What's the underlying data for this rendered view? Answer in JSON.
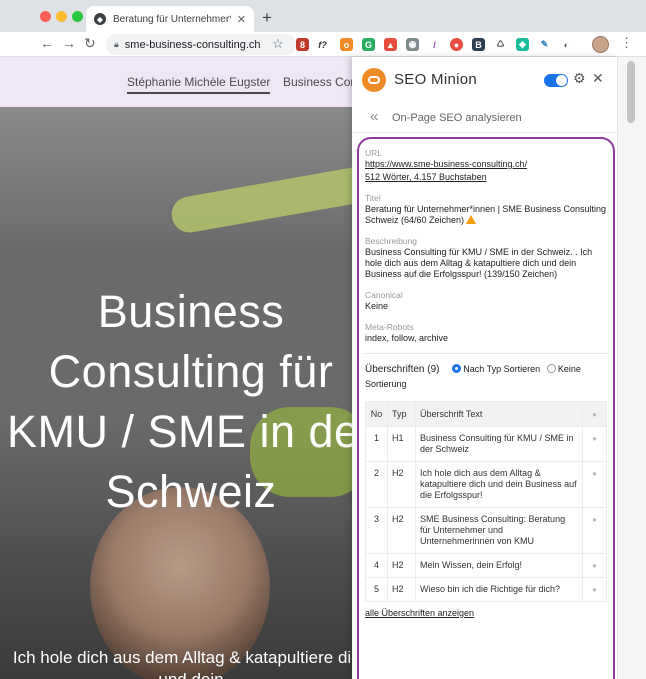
{
  "browser": {
    "tab_title": "Beratung für Unternehmer*inne",
    "new_tab": "+",
    "url": "sme-business-consulting.ch"
  },
  "site": {
    "nav": [
      "Stéphanie Michèle Eugster",
      "Business Cons"
    ],
    "hero_title": "Business Consulting für KMU / SME in der Schweiz",
    "hero_subtitle": "Ich hole dich aus dem Alltag & katapultiere dich und dein"
  },
  "panel": {
    "brand": "SEO Minion",
    "subtitle": "On-Page SEO analysieren",
    "url_label": "URL",
    "url_value": "https://www.sme-business-consulting.ch/",
    "url_stats": "512 Wörter, 4.157 Buchstaben",
    "title_label": "Titel",
    "title_value": "Beratung für Unternehmer*innen | SME Business Consulting Schweiz (64/60 Zeichen)",
    "desc_label": "Beschreibung",
    "desc_value": "Business Consulting für KMU / SME in der Schweiz. . Ich hole dich aus dem Alltag & katapultiere dich und dein Business auf die Erfolgsspur! (139/150 Zeichen)",
    "canonical_label": "Canonical",
    "canonical_value": "Keine",
    "robots_label": "Meta-Robots",
    "robots_value": "index, follow, archive",
    "headings_label": "Überschriften (9)",
    "sort_type": "Nach Typ Sortieren",
    "sort_none": "Keine",
    "sort_suffix": "Sortierung",
    "table": {
      "col_no": "No",
      "col_type": "Typ",
      "col_text": "Überschrift Text",
      "rows": [
        {
          "no": "1",
          "type": "H1",
          "text": "Business Consulting für KMU / SME in der Schweiz"
        },
        {
          "no": "2",
          "type": "H2",
          "text": "Ich hole dich aus dem Alltag & katapultiere dich und dein Business auf die Erfolgsspur!"
        },
        {
          "no": "3",
          "type": "H2",
          "text": "SME Business Consulting: Beratung für Unternehmer und Unternehmerinnen von KMU"
        },
        {
          "no": "4",
          "type": "H2",
          "text": "Mein Wissen, dein Erfolg!"
        },
        {
          "no": "5",
          "type": "H2",
          "text": "Wieso bin ich die Richtige für dich?"
        }
      ]
    },
    "show_all": "alle Überschriften anzeigen"
  }
}
